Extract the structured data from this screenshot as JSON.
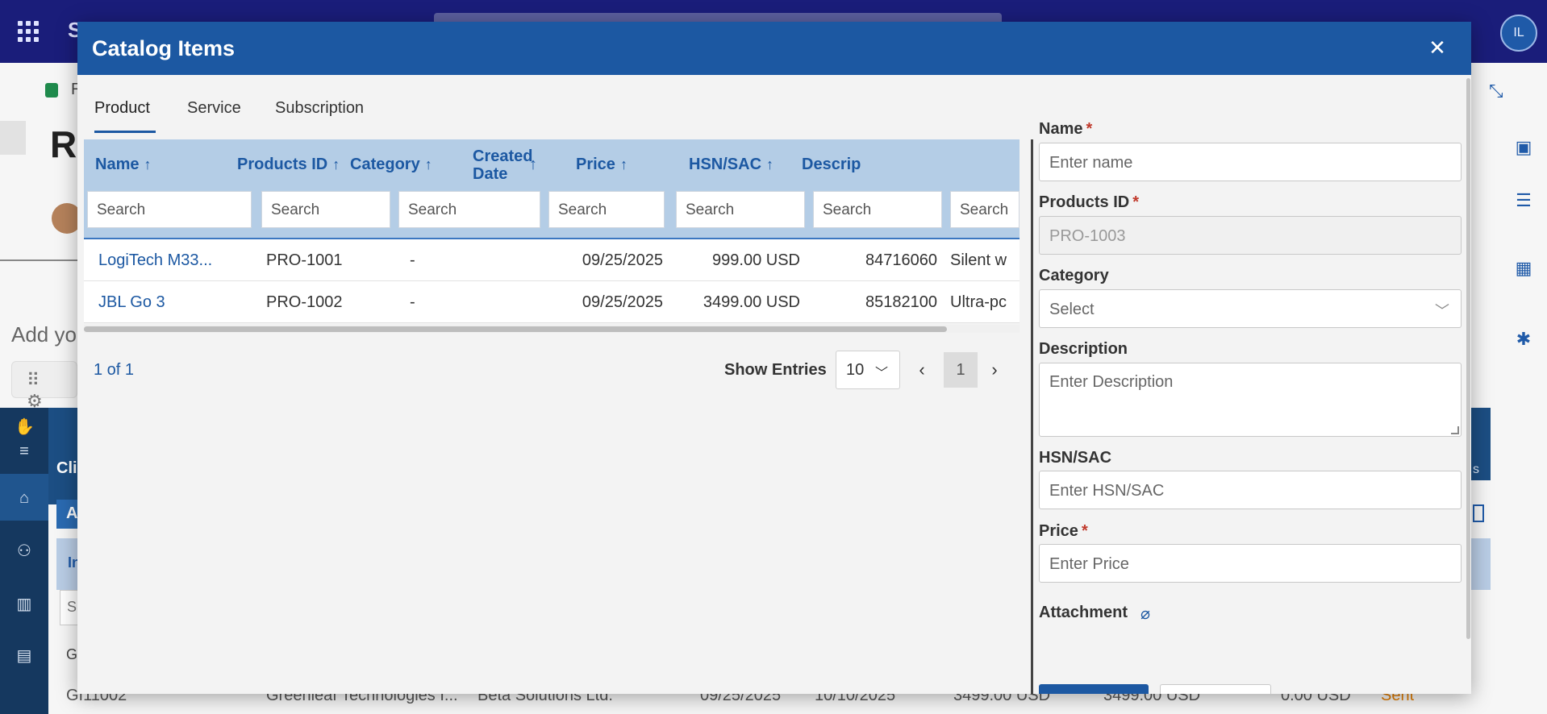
{
  "background": {
    "app_initial": "S",
    "user_initials": "IL",
    "breadcrumb": "R",
    "page_title": "Re",
    "add_text": "Add yo",
    "toolbar_glyphs": "⠿ ⚙",
    "cli_label": "Cli",
    "a_label": "A",
    "in_label": "In",
    "s_label": "S",
    "g_label": "G",
    "right_band_label": "s",
    "bottom_row": {
      "id": "GI11002",
      "client": "Greenleaf Technologies I...",
      "company": "Beta Solutions Ltd.",
      "date1": "09/25/2025",
      "date2": "10/10/2025",
      "amount1": "3499.00 USD",
      "amount2": "3499.00 USD",
      "amount3": "0.00 USD",
      "status": "Sent"
    }
  },
  "modal": {
    "title": "Catalog Items",
    "close_icon": "✕"
  },
  "tabs": [
    {
      "label": "Product",
      "active": true
    },
    {
      "label": "Service",
      "active": false
    },
    {
      "label": "Subscription",
      "active": false
    }
  ],
  "grid": {
    "columns": [
      {
        "label": "Name",
        "arrow": "↑"
      },
      {
        "label": "Products ID",
        "arrow": "↑"
      },
      {
        "label": "Category",
        "arrow": "↑"
      },
      {
        "label_line1": "Created",
        "label_line2": "Date",
        "arrow": "↑"
      },
      {
        "label": "Price",
        "arrow": "↑"
      },
      {
        "label": "HSN/SAC",
        "arrow": "↑"
      },
      {
        "label": "Descrip"
      }
    ],
    "search_placeholder": "Search",
    "rows": [
      {
        "name": "LogiTech M33...",
        "product_id": "PRO-1001",
        "category": "-",
        "created": "09/25/2025",
        "price": "999.00 USD",
        "hsn": "84716060",
        "description": "Silent w"
      },
      {
        "name": "JBL Go 3",
        "product_id": "PRO-1002",
        "category": "-",
        "created": "09/25/2025",
        "price": "3499.00 USD",
        "hsn": "85182100",
        "description": "Ultra-pc"
      }
    ]
  },
  "pager": {
    "count": "1 of 1",
    "show_entries_label": "Show Entries",
    "entries_value": "10",
    "current_page": "1",
    "prev_icon": "‹",
    "next_icon": "›"
  },
  "form": {
    "name_label": "Name",
    "name_placeholder": "Enter name",
    "products_id_label": "Products ID",
    "products_id_value": "PRO-1003",
    "category_label": "Category",
    "category_placeholder": "Select",
    "description_label": "Description",
    "description_placeholder": "Enter Description",
    "hsn_label": "HSN/SAC",
    "hsn_placeholder": "Enter HSN/SAC",
    "price_label": "Price",
    "price_placeholder": "Enter Price",
    "attachment_label": "Attachment",
    "required_mark": "*"
  },
  "colors": {
    "header_blue": "#1c58a2",
    "grid_header_bg": "#b4cde6",
    "topbar": "#1a1d7a",
    "required": "#c0392b"
  }
}
